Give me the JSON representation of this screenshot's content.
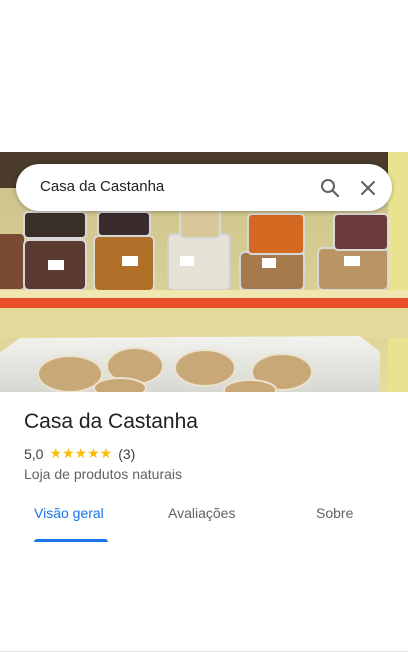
{
  "search": {
    "query": "Casa da Castanha",
    "search_icon": "search-icon",
    "close_icon": "close-icon"
  },
  "place": {
    "name": "Casa da Castanha",
    "rating": "5,0",
    "stars": "★★★★★",
    "review_count": "(3)",
    "category": "Loja de produtos naturais"
  },
  "tabs": [
    {
      "label": "Visão geral",
      "active": true
    },
    {
      "label": "Avaliações",
      "active": false
    },
    {
      "label": "Sobre",
      "active": false
    }
  ],
  "colors": {
    "accent": "#1a73e8",
    "star": "#fbbc04",
    "shelf_edge": "#e8502a"
  }
}
